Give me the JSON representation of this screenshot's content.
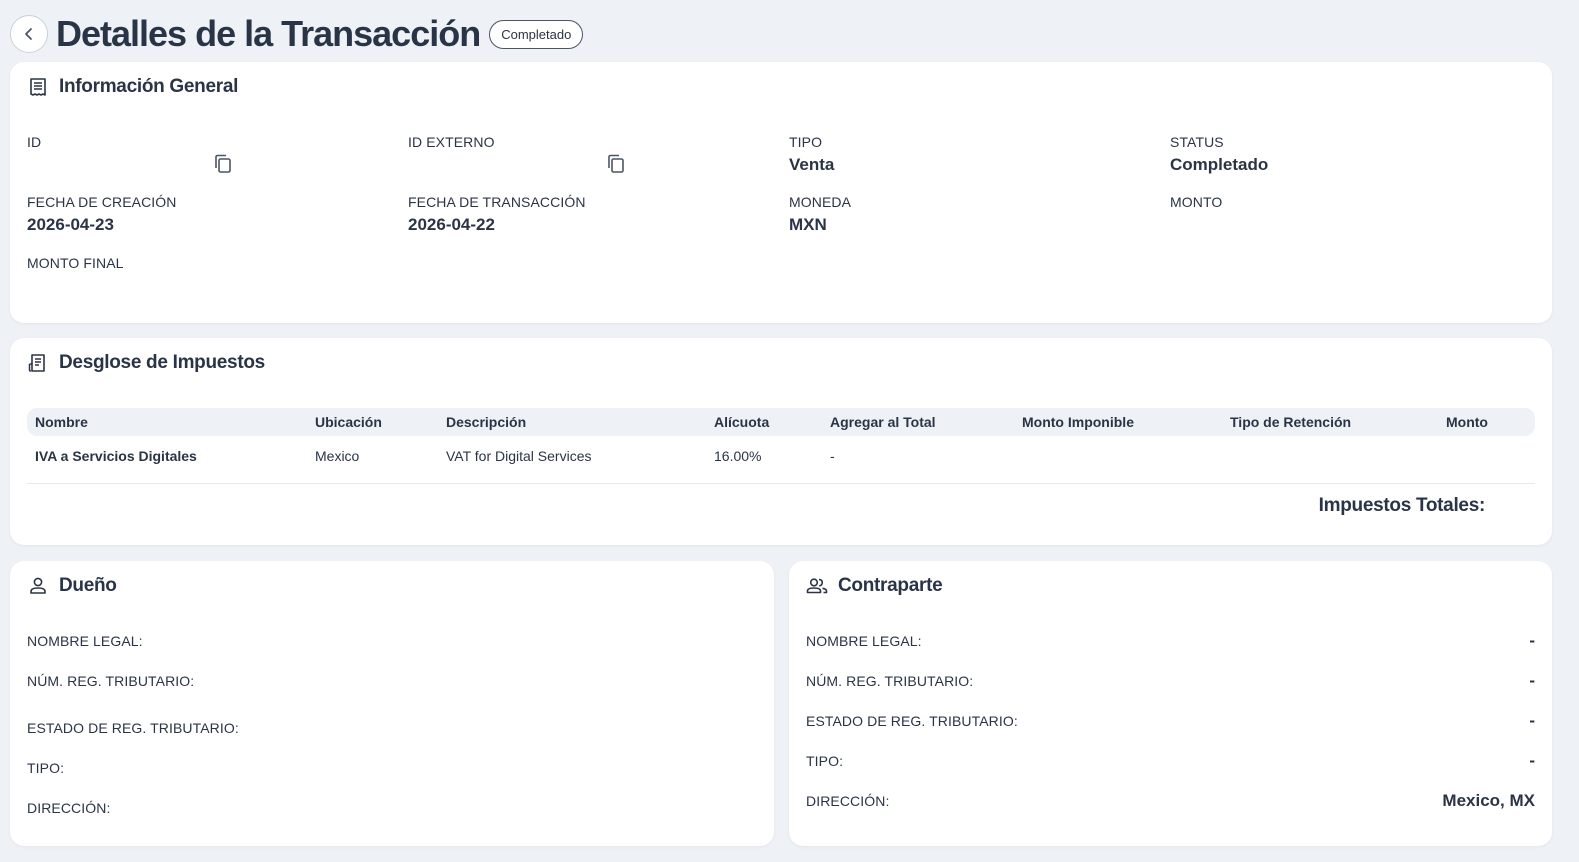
{
  "header": {
    "title": "Detalles de la Transacción",
    "status": "Completado"
  },
  "general": {
    "title": "Información General",
    "fields": {
      "id": {
        "label": "ID",
        "value": ""
      },
      "id_externo": {
        "label": "ID EXTERNO",
        "value": ""
      },
      "tipo": {
        "label": "TIPO",
        "value": "Venta"
      },
      "status": {
        "label": "STATUS",
        "value": "Completado"
      },
      "fecha_creacion": {
        "label": "FECHA DE CREACIÓN",
        "value": "2026-04-23"
      },
      "fecha_transaccion": {
        "label": "FECHA DE TRANSACCIÓN",
        "value": "2026-04-22"
      },
      "moneda": {
        "label": "MONEDA",
        "value": "MXN"
      },
      "monto": {
        "label": "MONTO",
        "value": ""
      },
      "monto_final": {
        "label": "MONTO FINAL",
        "value": ""
      }
    }
  },
  "taxes": {
    "title": "Desglose de Impuestos",
    "columns": [
      "Nombre",
      "Ubicación",
      "Descripción",
      "Alícuota",
      "Agregar al Total",
      "Monto Imponible",
      "Tipo de Retención",
      "Monto"
    ],
    "rows": [
      [
        "IVA a Servicios Digitales",
        "Mexico",
        "VAT for Digital Services",
        "16.00%",
        "-",
        "",
        "",
        ""
      ]
    ],
    "total_label": "Impuestos Totales:"
  },
  "owner": {
    "title": "Dueño",
    "items": [
      {
        "label": "NOMBRE LEGAL:",
        "value": ""
      },
      {
        "label": "NÚM. REG. TRIBUTARIO:",
        "value": ""
      },
      {
        "label": "ESTADO DE REG. TRIBUTARIO:",
        "value": ""
      },
      {
        "label": "TIPO:",
        "value": ""
      },
      {
        "label": "DIRECCIÓN:",
        "value": ""
      }
    ]
  },
  "counterparty": {
    "title": "Contraparte",
    "items": [
      {
        "label": "NOMBRE LEGAL:",
        "value": "-"
      },
      {
        "label": "NÚM. REG. TRIBUTARIO:",
        "value": "-"
      },
      {
        "label": "ESTADO DE REG. TRIBUTARIO:",
        "value": "-"
      },
      {
        "label": "TIPO:",
        "value": "-"
      },
      {
        "label": "DIRECCIÓN:",
        "value": "Mexico, MX"
      }
    ]
  }
}
